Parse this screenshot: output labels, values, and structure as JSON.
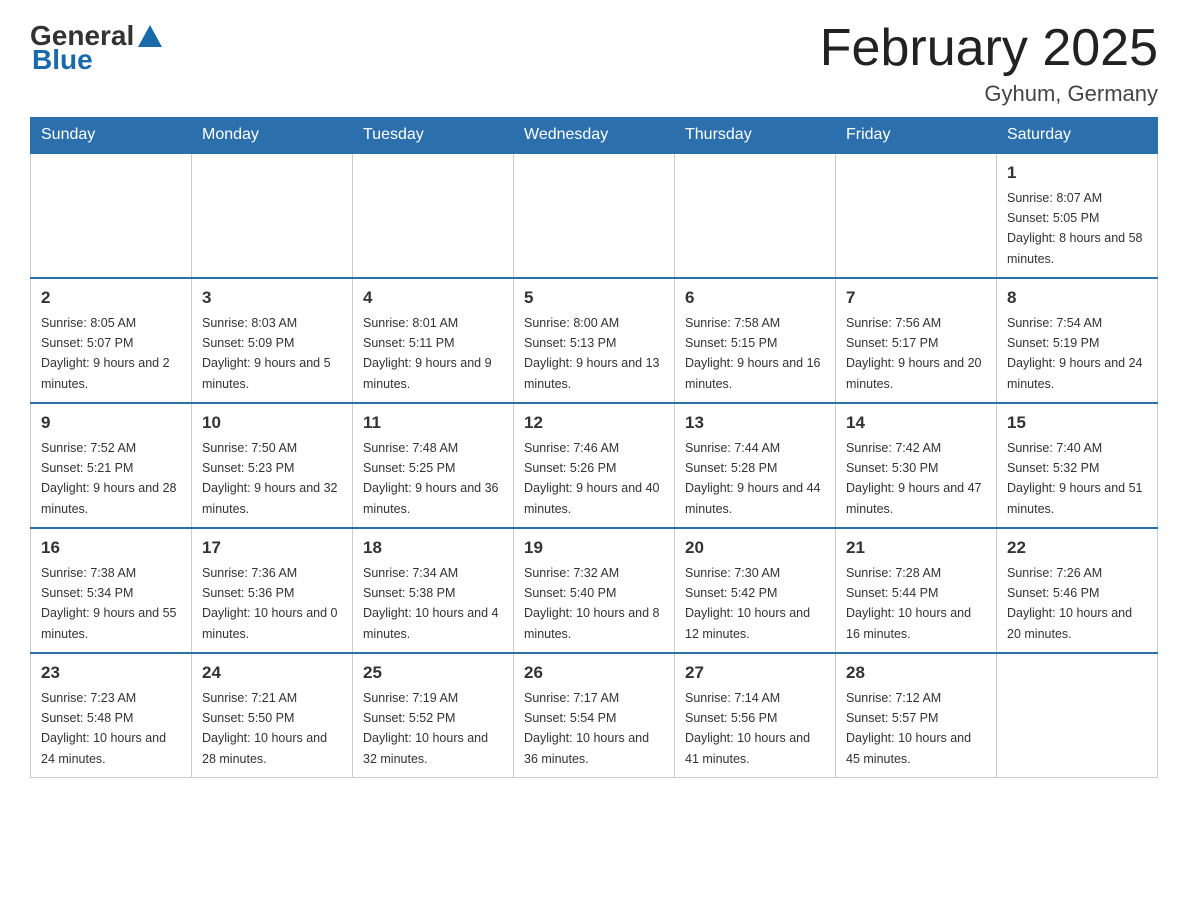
{
  "header": {
    "logo": {
      "text_general": "General",
      "text_blue": "Blue"
    },
    "title": "February 2025",
    "subtitle": "Gyhum, Germany"
  },
  "weekdays": [
    "Sunday",
    "Monday",
    "Tuesday",
    "Wednesday",
    "Thursday",
    "Friday",
    "Saturday"
  ],
  "weeks": [
    [
      {
        "day": "",
        "info": ""
      },
      {
        "day": "",
        "info": ""
      },
      {
        "day": "",
        "info": ""
      },
      {
        "day": "",
        "info": ""
      },
      {
        "day": "",
        "info": ""
      },
      {
        "day": "",
        "info": ""
      },
      {
        "day": "1",
        "info": "Sunrise: 8:07 AM\nSunset: 5:05 PM\nDaylight: 8 hours and 58 minutes."
      }
    ],
    [
      {
        "day": "2",
        "info": "Sunrise: 8:05 AM\nSunset: 5:07 PM\nDaylight: 9 hours and 2 minutes."
      },
      {
        "day": "3",
        "info": "Sunrise: 8:03 AM\nSunset: 5:09 PM\nDaylight: 9 hours and 5 minutes."
      },
      {
        "day": "4",
        "info": "Sunrise: 8:01 AM\nSunset: 5:11 PM\nDaylight: 9 hours and 9 minutes."
      },
      {
        "day": "5",
        "info": "Sunrise: 8:00 AM\nSunset: 5:13 PM\nDaylight: 9 hours and 13 minutes."
      },
      {
        "day": "6",
        "info": "Sunrise: 7:58 AM\nSunset: 5:15 PM\nDaylight: 9 hours and 16 minutes."
      },
      {
        "day": "7",
        "info": "Sunrise: 7:56 AM\nSunset: 5:17 PM\nDaylight: 9 hours and 20 minutes."
      },
      {
        "day": "8",
        "info": "Sunrise: 7:54 AM\nSunset: 5:19 PM\nDaylight: 9 hours and 24 minutes."
      }
    ],
    [
      {
        "day": "9",
        "info": "Sunrise: 7:52 AM\nSunset: 5:21 PM\nDaylight: 9 hours and 28 minutes."
      },
      {
        "day": "10",
        "info": "Sunrise: 7:50 AM\nSunset: 5:23 PM\nDaylight: 9 hours and 32 minutes."
      },
      {
        "day": "11",
        "info": "Sunrise: 7:48 AM\nSunset: 5:25 PM\nDaylight: 9 hours and 36 minutes."
      },
      {
        "day": "12",
        "info": "Sunrise: 7:46 AM\nSunset: 5:26 PM\nDaylight: 9 hours and 40 minutes."
      },
      {
        "day": "13",
        "info": "Sunrise: 7:44 AM\nSunset: 5:28 PM\nDaylight: 9 hours and 44 minutes."
      },
      {
        "day": "14",
        "info": "Sunrise: 7:42 AM\nSunset: 5:30 PM\nDaylight: 9 hours and 47 minutes."
      },
      {
        "day": "15",
        "info": "Sunrise: 7:40 AM\nSunset: 5:32 PM\nDaylight: 9 hours and 51 minutes."
      }
    ],
    [
      {
        "day": "16",
        "info": "Sunrise: 7:38 AM\nSunset: 5:34 PM\nDaylight: 9 hours and 55 minutes."
      },
      {
        "day": "17",
        "info": "Sunrise: 7:36 AM\nSunset: 5:36 PM\nDaylight: 10 hours and 0 minutes."
      },
      {
        "day": "18",
        "info": "Sunrise: 7:34 AM\nSunset: 5:38 PM\nDaylight: 10 hours and 4 minutes."
      },
      {
        "day": "19",
        "info": "Sunrise: 7:32 AM\nSunset: 5:40 PM\nDaylight: 10 hours and 8 minutes."
      },
      {
        "day": "20",
        "info": "Sunrise: 7:30 AM\nSunset: 5:42 PM\nDaylight: 10 hours and 12 minutes."
      },
      {
        "day": "21",
        "info": "Sunrise: 7:28 AM\nSunset: 5:44 PM\nDaylight: 10 hours and 16 minutes."
      },
      {
        "day": "22",
        "info": "Sunrise: 7:26 AM\nSunset: 5:46 PM\nDaylight: 10 hours and 20 minutes."
      }
    ],
    [
      {
        "day": "23",
        "info": "Sunrise: 7:23 AM\nSunset: 5:48 PM\nDaylight: 10 hours and 24 minutes."
      },
      {
        "day": "24",
        "info": "Sunrise: 7:21 AM\nSunset: 5:50 PM\nDaylight: 10 hours and 28 minutes."
      },
      {
        "day": "25",
        "info": "Sunrise: 7:19 AM\nSunset: 5:52 PM\nDaylight: 10 hours and 32 minutes."
      },
      {
        "day": "26",
        "info": "Sunrise: 7:17 AM\nSunset: 5:54 PM\nDaylight: 10 hours and 36 minutes."
      },
      {
        "day": "27",
        "info": "Sunrise: 7:14 AM\nSunset: 5:56 PM\nDaylight: 10 hours and 41 minutes."
      },
      {
        "day": "28",
        "info": "Sunrise: 7:12 AM\nSunset: 5:57 PM\nDaylight: 10 hours and 45 minutes."
      },
      {
        "day": "",
        "info": ""
      }
    ]
  ]
}
